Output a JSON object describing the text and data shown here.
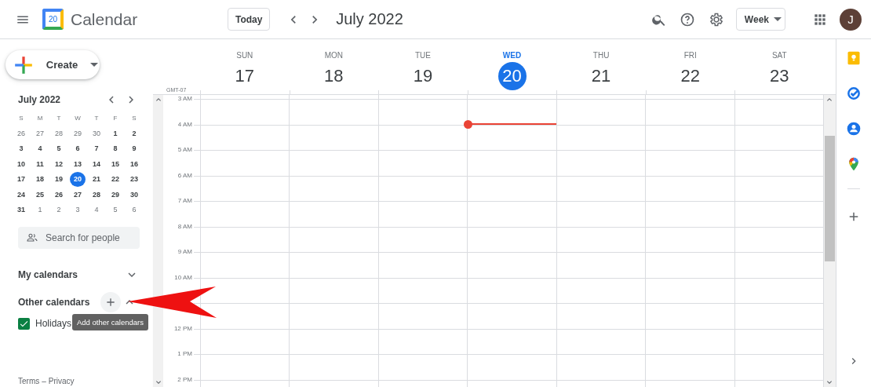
{
  "header": {
    "logo_day": "20",
    "app_name": "Calendar",
    "today_button": "Today",
    "period": "July 2022",
    "view": "Week",
    "avatar_initial": "J"
  },
  "sidebar": {
    "create": "Create",
    "mini_calendar": {
      "title": "July 2022",
      "weekdays": [
        "S",
        "M",
        "T",
        "W",
        "T",
        "F",
        "S"
      ],
      "weeks": [
        [
          {
            "day": "26",
            "outside": true,
            "selected": false
          },
          {
            "day": "27",
            "outside": true,
            "selected": false
          },
          {
            "day": "28",
            "outside": true,
            "selected": false
          },
          {
            "day": "29",
            "outside": true,
            "selected": false
          },
          {
            "day": "30",
            "outside": true,
            "selected": false
          },
          {
            "day": "1",
            "outside": false,
            "selected": false
          },
          {
            "day": "2",
            "outside": false,
            "selected": false
          }
        ],
        [
          {
            "day": "3",
            "outside": false,
            "selected": false
          },
          {
            "day": "4",
            "outside": false,
            "selected": false
          },
          {
            "day": "5",
            "outside": false,
            "selected": false
          },
          {
            "day": "6",
            "outside": false,
            "selected": false
          },
          {
            "day": "7",
            "outside": false,
            "selected": false
          },
          {
            "day": "8",
            "outside": false,
            "selected": false
          },
          {
            "day": "9",
            "outside": false,
            "selected": false
          }
        ],
        [
          {
            "day": "10",
            "outside": false,
            "selected": false
          },
          {
            "day": "11",
            "outside": false,
            "selected": false
          },
          {
            "day": "12",
            "outside": false,
            "selected": false
          },
          {
            "day": "13",
            "outside": false,
            "selected": false
          },
          {
            "day": "14",
            "outside": false,
            "selected": false
          },
          {
            "day": "15",
            "outside": false,
            "selected": false
          },
          {
            "day": "16",
            "outside": false,
            "selected": false
          }
        ],
        [
          {
            "day": "17",
            "outside": false,
            "selected": false
          },
          {
            "day": "18",
            "outside": false,
            "selected": false
          },
          {
            "day": "19",
            "outside": false,
            "selected": false
          },
          {
            "day": "20",
            "outside": false,
            "selected": true
          },
          {
            "day": "21",
            "outside": false,
            "selected": false
          },
          {
            "day": "22",
            "outside": false,
            "selected": false
          },
          {
            "day": "23",
            "outside": false,
            "selected": false
          }
        ],
        [
          {
            "day": "24",
            "outside": false,
            "selected": false
          },
          {
            "day": "25",
            "outside": false,
            "selected": false
          },
          {
            "day": "26",
            "outside": false,
            "selected": false
          },
          {
            "day": "27",
            "outside": false,
            "selected": false
          },
          {
            "day": "28",
            "outside": false,
            "selected": false
          },
          {
            "day": "29",
            "outside": false,
            "selected": false
          },
          {
            "day": "30",
            "outside": false,
            "selected": false
          }
        ],
        [
          {
            "day": "31",
            "outside": false,
            "selected": false
          },
          {
            "day": "1",
            "outside": true,
            "selected": false
          },
          {
            "day": "2",
            "outside": true,
            "selected": false
          },
          {
            "day": "3",
            "outside": true,
            "selected": false
          },
          {
            "day": "4",
            "outside": true,
            "selected": false
          },
          {
            "day": "5",
            "outside": true,
            "selected": false
          },
          {
            "day": "6",
            "outside": true,
            "selected": false
          }
        ]
      ]
    },
    "search": {
      "placeholder": "Search for people"
    },
    "sections": [
      {
        "label": "My calendars",
        "expanded": false,
        "add_button": false
      },
      {
        "label": "Other calendars",
        "expanded": true,
        "add_button": true
      }
    ],
    "calendars": [
      {
        "name": "Holidays",
        "checked": true,
        "color": "#0b8043"
      }
    ],
    "footer": {
      "terms": "Terms",
      "separator": "–",
      "privacy": "Privacy"
    }
  },
  "week": {
    "timezone": "GMT-07",
    "days": [
      {
        "name": "SUN",
        "date": "17",
        "selected": false,
        "now_line": false
      },
      {
        "name": "MON",
        "date": "18",
        "selected": false,
        "now_line": false
      },
      {
        "name": "TUE",
        "date": "19",
        "selected": false,
        "now_line": false
      },
      {
        "name": "WED",
        "date": "20",
        "selected": true,
        "now_line": true
      },
      {
        "name": "THU",
        "date": "21",
        "selected": false,
        "now_line": false
      },
      {
        "name": "FRI",
        "date": "22",
        "selected": false,
        "now_line": false
      },
      {
        "name": "SAT",
        "date": "23",
        "selected": false,
        "now_line": false
      }
    ],
    "hours": [
      {
        "kind": "hour",
        "label": "3 AM"
      },
      {
        "kind": "hour",
        "label": "4 AM"
      },
      {
        "kind": "hour",
        "label": "5 AM"
      },
      {
        "kind": "hour",
        "label": "6 AM"
      },
      {
        "kind": "hour",
        "label": "7 AM"
      },
      {
        "kind": "hour",
        "label": "8 AM"
      },
      {
        "kind": "hour",
        "label": "9 AM"
      },
      {
        "kind": "hour",
        "label": "10 AM"
      },
      {
        "kind": "blank"
      },
      {
        "kind": "hour",
        "label": "12 PM"
      },
      {
        "kind": "hour",
        "label": "1 PM"
      },
      {
        "kind": "hour",
        "label": "2 PM"
      }
    ]
  },
  "tooltip": {
    "text": "Add other calendars"
  }
}
